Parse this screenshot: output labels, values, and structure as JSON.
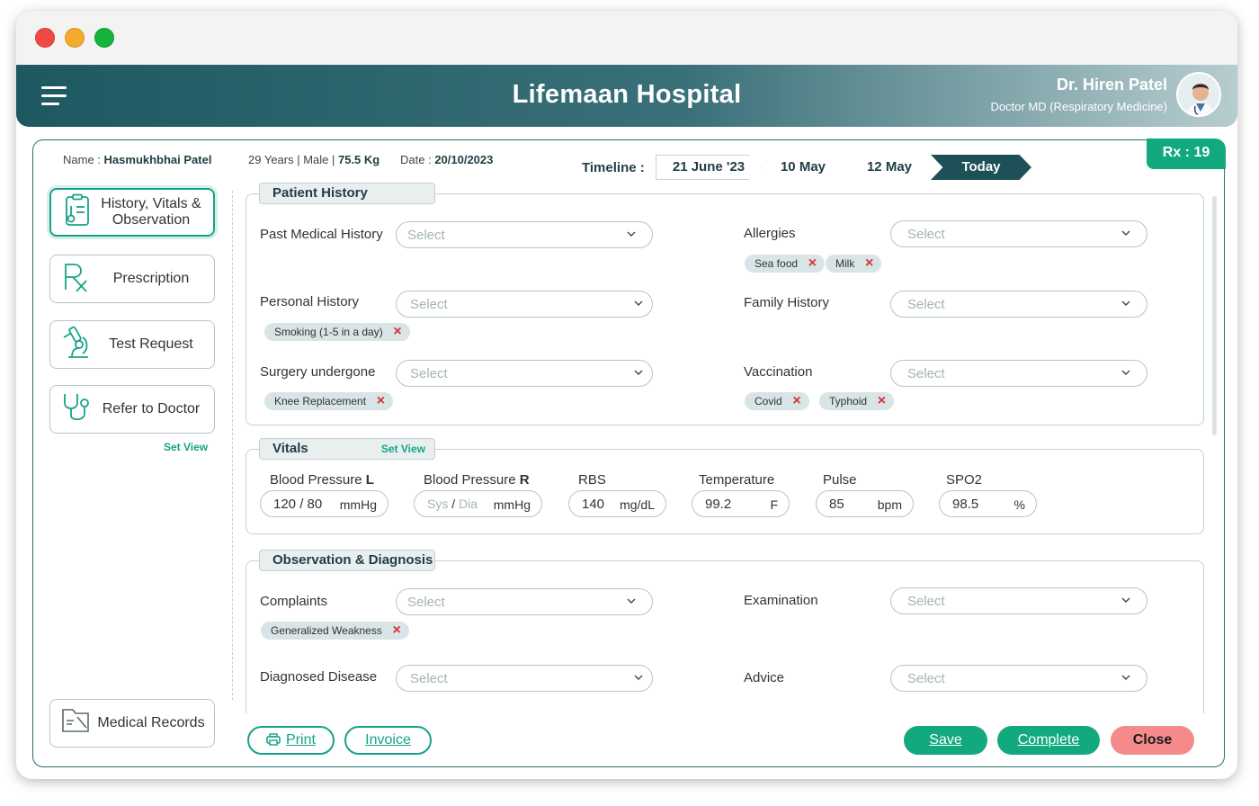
{
  "header": {
    "hospital_name": "Lifemaan Hospital",
    "doctor_name": "Dr. Hiren Patel",
    "doctor_title": "Doctor MD (Respiratory Medicine)"
  },
  "patient": {
    "name_label": "Name :",
    "name": "Hasmukhbhai Patel",
    "age_prefix": "29 Years | Male | ",
    "weight": "75.5 Kg",
    "date_label": "Date :",
    "date": "20/10/2023"
  },
  "rx": "Rx : 19",
  "timeline": {
    "label": "Timeline :",
    "items": [
      "21 June '23",
      "10 May",
      "12 May",
      "Today"
    ]
  },
  "nav": {
    "history": "History, Vitals & Observation",
    "prescription": "Prescription",
    "test_request": "Test Request",
    "refer": "Refer to Doctor",
    "set_view": "Set View",
    "medical_records": "Medical Records"
  },
  "select_placeholder": "Select",
  "patient_history": {
    "title": "Patient History",
    "past_medical": "Past Medical History",
    "allergies": "Allergies",
    "allergy_chips": [
      "Sea food",
      "Milk"
    ],
    "personal": "Personal History",
    "personal_chips": [
      "Smoking (1-5 in a day)"
    ],
    "family": "Family History",
    "surgery": "Surgery undergone",
    "surgery_chips": [
      "Knee Replacement"
    ],
    "vaccination": "Vaccination",
    "vaccination_chips": [
      "Covid",
      "Typhoid"
    ]
  },
  "vitals": {
    "title": "Vitals",
    "set_view": "Set View",
    "bp_l_label": "Blood Pressure ",
    "bp_l_side": "L",
    "bp_l_value": "120 / 80",
    "bp_unit": "mmHg",
    "bp_r_label": "Blood Pressure ",
    "bp_r_side": "R",
    "bp_r_sys": "Sys",
    "bp_r_slash": " / ",
    "bp_r_dia": "Dia",
    "rbs_label": "RBS",
    "rbs_value": "140",
    "rbs_unit": "mg/dL",
    "temp_label": "Temperature",
    "temp_value": "99.2",
    "temp_unit": "F",
    "pulse_label": "Pulse",
    "pulse_value": "85",
    "pulse_unit": "bpm",
    "spo2_label": "SPO2",
    "spo2_value": "98.5",
    "spo2_unit": "%"
  },
  "observation": {
    "title": "Observation & Diagnosis",
    "complaints": "Complaints",
    "complaint_chips": [
      "Generalized Weakness"
    ],
    "examination": "Examination",
    "diagnosed": "Diagnosed Disease",
    "advice": "Advice"
  },
  "actions": {
    "print": "Print",
    "invoice": "Invoice",
    "save": "Save",
    "complete": "Complete",
    "close": "Close"
  },
  "colors": {
    "accent": "#16a385",
    "header_dark": "#1e5860",
    "close_btn": "#f58a8a",
    "chip_bg": "#d8e4e5",
    "chip_x": "#dc2f36"
  }
}
